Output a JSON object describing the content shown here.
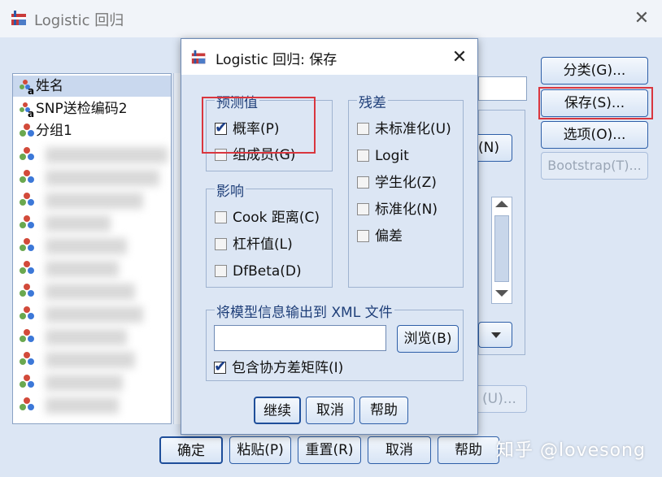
{
  "main_window": {
    "title": "Logistic 回归",
    "right_buttons": [
      {
        "label": "分类(G)..."
      },
      {
        "label": "保存(S)..."
      },
      {
        "label": "选项(O)..."
      },
      {
        "label": "Bootstrap(T)..."
      }
    ],
    "variables": [
      "姓名",
      "SNP送检编码2",
      "分组1"
    ],
    "partial_button_1": "(N)",
    "partial_button_2": "(U)...",
    "bottom_buttons": [
      {
        "label": "确定"
      },
      {
        "label": "粘贴(P)"
      },
      {
        "label": "重置(R)"
      },
      {
        "label": "取消"
      },
      {
        "label": "帮助"
      }
    ]
  },
  "dialog": {
    "title": "Logistic 回归: 保存",
    "predicted_group": {
      "label": "预测值",
      "options": [
        {
          "label": "概率(P)",
          "checked": true
        },
        {
          "label": "组成员(G)",
          "checked": false
        }
      ]
    },
    "residuals_group": {
      "label": "残差",
      "options": [
        {
          "label": "未标准化(U)",
          "checked": false
        },
        {
          "label": "Logit",
          "checked": false
        },
        {
          "label": "学生化(Z)",
          "checked": false
        },
        {
          "label": "标准化(N)",
          "checked": false
        },
        {
          "label": "偏差",
          "checked": false
        }
      ]
    },
    "influence_group": {
      "label": "影响",
      "options": [
        {
          "label": "Cook 距离(C)",
          "checked": false
        },
        {
          "label": "杠杆值(L)",
          "checked": false
        },
        {
          "label": "DfBeta(D)",
          "checked": false
        }
      ]
    },
    "xml_group": {
      "label": "将模型信息输出到 XML 文件",
      "input_value": "",
      "browse_label": "浏览(B)",
      "include_cov": {
        "label": "包含协方差矩阵(I)",
        "checked": true
      }
    },
    "buttons": [
      {
        "label": "继续"
      },
      {
        "label": "取消"
      },
      {
        "label": "帮助"
      }
    ]
  },
  "watermark": "知乎 @lovesong",
  "colors": {
    "accent_border": "#2e5fa8",
    "highlight_box": "#d9363e",
    "dialog_bg": "#dce6f4"
  }
}
